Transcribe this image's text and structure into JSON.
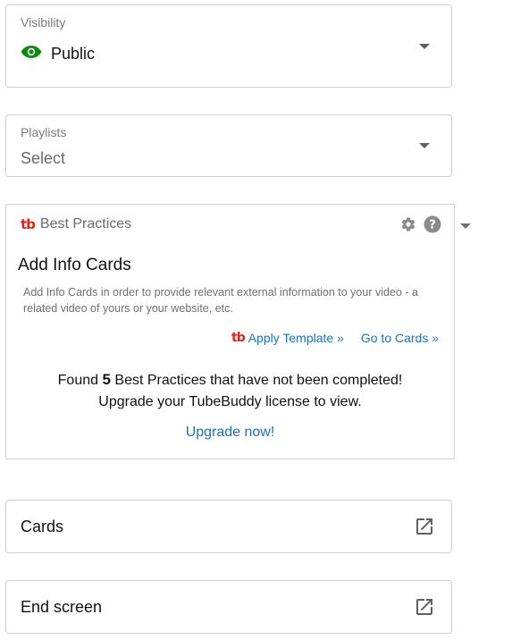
{
  "visibility": {
    "label": "Visibility",
    "value": "Public",
    "icon": "eye-icon",
    "icon_color": "#0f8a0f"
  },
  "playlists": {
    "label": "Playlists",
    "value": "Select"
  },
  "best_practices": {
    "logo_text": "tb",
    "title": "Best Practices",
    "heading": "Add Info Cards",
    "description": "Add Info Cards in order to provide relevant external information to your video - a related video of yours or your website, etc.",
    "apply_template": "Apply Template »",
    "go_to_cards": "Go to Cards »",
    "found_prefix": "Found",
    "found_count": "5",
    "found_suffix": "Best Practices that have not been completed!",
    "upgrade_text": "Upgrade your TubeBuddy license to view.",
    "upgrade_link": "Upgrade now!",
    "brand_color": "#e2231a",
    "link_color": "#1a73b8"
  },
  "cards": {
    "title": "Cards",
    "icon": "external-link-icon"
  },
  "end_screen": {
    "title": "End screen",
    "icon": "external-link-icon"
  }
}
